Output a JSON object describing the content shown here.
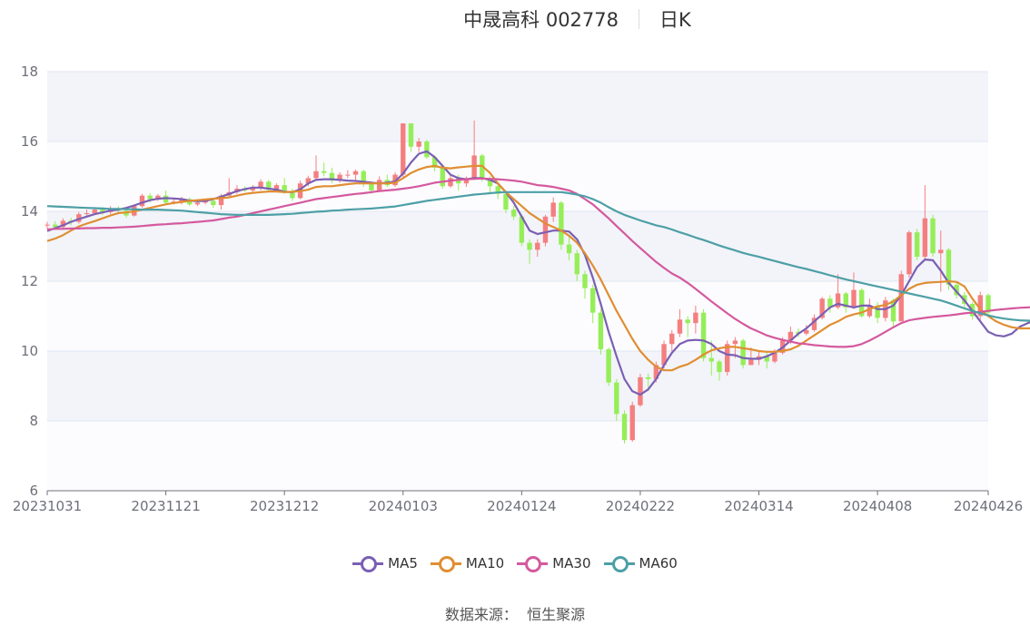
{
  "header": {
    "title": "中晟高科 002778",
    "period": "日K"
  },
  "source_text": "数据来源：  恒生聚源",
  "colors": {
    "up": "#f47f80",
    "down": "#95ee58",
    "band": "#f2f4f9",
    "grid": "#e0e6f1",
    "axis": "#6e7079",
    "text": "#333333"
  },
  "chart_data": {
    "type": "candlestick",
    "title": "中晟高科 002778",
    "xlabel": "",
    "ylabel": "",
    "ylim": [
      6,
      18
    ],
    "yticks": [
      6,
      8,
      10,
      12,
      14,
      16,
      18
    ],
    "x_tick_labels": [
      "20231031",
      "20231121",
      "20231212",
      "20240103",
      "20240124",
      "20240222",
      "20240314",
      "20240408",
      "20240426"
    ],
    "x_tick_indices": [
      0,
      15,
      30,
      45,
      60,
      75,
      90,
      105,
      119
    ],
    "grid": true,
    "legend_position": "bottom",
    "num_days": 120,
    "candles": [
      [
        13.6,
        13.62,
        13.7,
        13.5
      ],
      [
        13.62,
        13.55,
        13.72,
        13.48
      ],
      [
        13.55,
        13.73,
        13.8,
        13.5
      ],
      [
        13.73,
        13.7,
        13.82,
        13.6
      ],
      [
        13.7,
        13.92,
        13.98,
        13.65
      ],
      [
        13.92,
        13.95,
        14.05,
        13.85
      ],
      [
        13.95,
        14.05,
        14.12,
        13.9
      ],
      [
        14.05,
        13.98,
        14.12,
        13.9
      ],
      [
        13.98,
        14.08,
        14.15,
        13.92
      ],
      [
        14.08,
        14.02,
        14.15,
        13.95
      ],
      [
        14.02,
        13.88,
        14.08,
        13.82
      ],
      [
        13.88,
        14.15,
        14.2,
        13.85
      ],
      [
        14.15,
        14.45,
        14.5,
        14.1
      ],
      [
        14.45,
        14.35,
        14.52,
        14.25
      ],
      [
        14.35,
        14.45,
        14.5,
        14.3
      ],
      [
        14.45,
        14.25,
        14.6,
        14.2
      ],
      [
        14.25,
        14.28,
        14.35,
        14.2
      ],
      [
        14.28,
        14.35,
        14.42,
        14.2
      ],
      [
        14.35,
        14.2,
        14.4,
        14.15
      ],
      [
        14.2,
        14.25,
        14.3,
        14.15
      ],
      [
        14.25,
        14.3,
        14.35,
        14.2
      ],
      [
        14.3,
        14.18,
        14.38,
        14.1
      ],
      [
        14.18,
        14.45,
        14.5,
        14.05
      ],
      [
        14.45,
        14.55,
        14.95,
        14.4
      ],
      [
        14.55,
        14.65,
        14.75,
        14.5
      ],
      [
        14.65,
        14.6,
        14.72,
        14.55
      ],
      [
        14.6,
        14.68,
        14.75,
        14.55
      ],
      [
        14.68,
        14.85,
        14.92,
        14.6
      ],
      [
        14.85,
        14.62,
        14.9,
        14.55
      ],
      [
        14.62,
        14.75,
        14.8,
        14.55
      ],
      [
        14.75,
        14.55,
        14.95,
        14.5
      ],
      [
        14.55,
        14.38,
        14.65,
        14.3
      ],
      [
        14.38,
        14.8,
        14.88,
        14.35
      ],
      [
        14.8,
        14.95,
        15.02,
        14.72
      ],
      [
        14.95,
        15.15,
        15.6,
        14.9
      ],
      [
        15.15,
        15.1,
        15.4,
        15.0
      ],
      [
        15.1,
        14.88,
        15.25,
        14.8
      ],
      [
        14.88,
        15.05,
        15.12,
        14.82
      ],
      [
        15.05,
        15.05,
        15.18,
        14.95
      ],
      [
        15.05,
        15.15,
        15.2,
        14.85
      ],
      [
        15.15,
        14.78,
        15.2,
        14.7
      ],
      [
        14.78,
        14.6,
        14.85,
        14.5
      ],
      [
        14.6,
        14.9,
        15.0,
        14.55
      ],
      [
        14.9,
        14.75,
        15.05,
        14.7
      ],
      [
        14.75,
        15.05,
        15.12,
        14.7
      ],
      [
        15.05,
        16.52,
        16.52,
        14.98
      ],
      [
        16.52,
        15.85,
        16.4,
        15.7
      ],
      [
        15.85,
        16.0,
        16.1,
        15.7
      ],
      [
        16.0,
        15.55,
        16.05,
        15.5
      ],
      [
        15.55,
        15.25,
        15.6,
        15.15
      ],
      [
        15.25,
        14.72,
        15.3,
        14.65
      ],
      [
        14.72,
        14.95,
        15.05,
        14.68
      ],
      [
        14.95,
        14.8,
        15.05,
        14.6
      ],
      [
        14.8,
        14.95,
        15.0,
        14.7
      ],
      [
        14.95,
        15.6,
        16.6,
        14.9
      ],
      [
        15.6,
        14.92,
        15.65,
        14.85
      ],
      [
        14.92,
        14.72,
        15.0,
        14.55
      ],
      [
        14.72,
        14.5,
        14.8,
        14.35
      ],
      [
        14.5,
        14.05,
        14.58,
        13.95
      ],
      [
        14.05,
        13.85,
        14.15,
        13.75
      ],
      [
        13.85,
        13.1,
        13.9,
        13.0
      ],
      [
        13.1,
        12.9,
        13.2,
        12.5
      ],
      [
        12.9,
        13.1,
        13.2,
        12.7
      ],
      [
        13.1,
        13.85,
        13.9,
        13.0
      ],
      [
        13.85,
        14.25,
        14.4,
        13.7
      ],
      [
        14.25,
        13.05,
        14.3,
        12.9
      ],
      [
        13.05,
        12.8,
        13.3,
        12.6
      ],
      [
        12.8,
        12.2,
        12.9,
        12.0
      ],
      [
        12.2,
        11.8,
        12.3,
        11.5
      ],
      [
        11.8,
        11.1,
        11.9,
        10.8
      ],
      [
        11.1,
        10.05,
        11.2,
        9.9
      ],
      [
        10.05,
        9.1,
        10.1,
        9.0
      ],
      [
        9.1,
        8.2,
        9.2,
        8.0
      ],
      [
        8.2,
        7.45,
        8.3,
        7.35
      ],
      [
        7.45,
        8.45,
        8.55,
        7.4
      ],
      [
        8.45,
        9.25,
        9.35,
        8.4
      ],
      [
        9.25,
        9.2,
        9.35,
        8.85
      ],
      [
        9.2,
        9.6,
        9.7,
        9.1
      ],
      [
        9.6,
        10.2,
        10.3,
        9.5
      ],
      [
        10.2,
        10.5,
        10.6,
        10.0
      ],
      [
        10.5,
        10.9,
        11.2,
        10.4
      ],
      [
        10.9,
        10.8,
        11.0,
        10.4
      ],
      [
        10.8,
        11.1,
        11.3,
        10.5
      ],
      [
        11.1,
        9.8,
        11.2,
        9.7
      ],
      [
        9.8,
        9.7,
        10.3,
        9.3
      ],
      [
        9.7,
        9.4,
        9.75,
        9.15
      ],
      [
        9.4,
        10.2,
        10.3,
        9.3
      ],
      [
        10.2,
        10.3,
        10.4,
        9.8
      ],
      [
        10.3,
        9.6,
        10.35,
        9.5
      ],
      [
        9.6,
        9.75,
        10.1,
        9.6
      ],
      [
        9.75,
        9.85,
        10.0,
        9.6
      ],
      [
        9.85,
        9.7,
        10.0,
        9.5
      ],
      [
        9.7,
        9.95,
        10.05,
        9.65
      ],
      [
        9.95,
        10.3,
        10.4,
        9.9
      ],
      [
        10.3,
        10.55,
        10.7,
        10.2
      ],
      [
        10.55,
        10.5,
        10.65,
        10.4
      ],
      [
        10.5,
        10.6,
        10.75,
        10.45
      ],
      [
        10.6,
        10.95,
        11.05,
        10.55
      ],
      [
        10.95,
        11.5,
        11.55,
        10.9
      ],
      [
        11.5,
        11.25,
        11.6,
        11.1
      ],
      [
        11.25,
        11.65,
        12.2,
        11.2
      ],
      [
        11.65,
        11.25,
        11.7,
        11.1
      ],
      [
        11.25,
        11.75,
        12.25,
        11.2
      ],
      [
        11.75,
        11.0,
        11.8,
        10.95
      ],
      [
        11.0,
        11.3,
        11.5,
        10.95
      ],
      [
        11.3,
        10.95,
        11.4,
        10.8
      ],
      [
        10.95,
        11.45,
        11.55,
        10.85
      ],
      [
        11.45,
        10.85,
        11.5,
        10.7
      ],
      [
        10.85,
        12.2,
        12.3,
        10.9
      ],
      [
        12.2,
        13.4,
        13.45,
        12.1
      ],
      [
        13.4,
        12.7,
        13.5,
        12.6
      ],
      [
        12.7,
        13.8,
        14.75,
        12.6
      ],
      [
        13.8,
        12.8,
        13.9,
        12.7
      ],
      [
        12.8,
        12.9,
        13.45,
        11.7
      ],
      [
        12.9,
        11.9,
        12.95,
        11.75
      ],
      [
        11.9,
        11.6,
        12.0,
        11.5
      ],
      [
        11.6,
        11.35,
        11.7,
        11.2
      ],
      [
        11.35,
        11.0,
        11.4,
        10.9
      ],
      [
        11.0,
        11.6,
        11.7,
        10.9
      ],
      [
        11.6,
        11.1,
        11.65,
        11.0
      ]
    ],
    "series": [
      {
        "name": "MA5",
        "color": "#7b5fb3",
        "values": [
          13.44,
          13.52,
          13.6,
          13.7,
          13.78,
          13.85,
          13.92,
          13.97,
          14.02,
          14.05,
          14.1,
          14.17,
          14.25,
          14.32,
          14.36,
          14.38,
          14.37,
          14.35,
          14.31,
          14.29,
          14.3,
          14.35,
          14.42,
          14.5,
          14.58,
          14.64,
          14.68,
          14.68,
          14.65,
          14.62,
          14.56,
          14.55,
          14.63,
          14.8,
          14.9,
          14.92,
          14.92,
          14.9,
          14.88,
          14.87,
          14.85,
          14.82,
          14.8,
          14.82,
          14.86,
          15.08,
          15.4,
          15.65,
          15.72,
          15.55,
          15.3,
          15.05,
          14.95,
          14.92,
          14.95,
          14.95,
          14.9,
          14.8,
          14.55,
          14.25,
          13.85,
          13.45,
          13.35,
          13.4,
          13.45,
          13.45,
          13.42,
          13.2,
          12.75,
          12.1,
          11.35,
          10.55,
          9.85,
          9.2,
          8.85,
          8.75,
          8.9,
          9.2,
          9.6,
          9.95,
          10.2,
          10.3,
          10.32,
          10.3,
          10.2,
          10.0,
          9.9,
          9.88,
          9.8,
          9.78,
          9.78,
          9.85,
          9.95,
          10.1,
          10.3,
          10.5,
          10.65,
          10.85,
          11.05,
          11.25,
          11.35,
          11.3,
          11.25,
          11.3,
          11.3,
          11.2,
          11.2,
          11.3,
          11.6,
          12.0,
          12.4,
          12.62,
          12.6,
          12.3,
          11.95,
          11.7,
          11.45,
          11.15,
          10.85,
          10.55,
          10.45,
          10.42,
          10.5,
          10.7,
          10.8,
          10.88
        ]
      },
      {
        "name": "MA10",
        "color": "#e08e32",
        "values": [
          13.15,
          13.22,
          13.32,
          13.45,
          13.57,
          13.65,
          13.72,
          13.8,
          13.88,
          13.95,
          13.97,
          14.0,
          14.05,
          14.1,
          14.15,
          14.2,
          14.24,
          14.27,
          14.3,
          14.32,
          14.34,
          14.36,
          14.38,
          14.4,
          14.45,
          14.5,
          14.53,
          14.55,
          14.57,
          14.57,
          14.55,
          14.56,
          14.58,
          14.62,
          14.7,
          14.72,
          14.72,
          14.75,
          14.78,
          14.8,
          14.8,
          14.8,
          14.8,
          14.8,
          14.82,
          14.95,
          15.1,
          15.2,
          15.27,
          15.3,
          15.25,
          15.23,
          15.26,
          15.28,
          15.3,
          15.3,
          15.1,
          14.8,
          14.55,
          14.35,
          14.15,
          13.95,
          13.8,
          13.65,
          13.55,
          13.45,
          13.3,
          13.1,
          12.8,
          12.45,
          12.05,
          11.6,
          11.15,
          10.75,
          10.35,
          10.0,
          9.75,
          9.55,
          9.45,
          9.45,
          9.55,
          9.62,
          9.75,
          9.9,
          10.02,
          10.08,
          10.12,
          10.12,
          10.08,
          10.05,
          10.0,
          9.98,
          9.98,
          10.0,
          10.05,
          10.15,
          10.3,
          10.45,
          10.6,
          10.75,
          10.85,
          10.98,
          11.05,
          11.1,
          11.2,
          11.28,
          11.32,
          11.42,
          11.6,
          11.78,
          11.9,
          11.95,
          11.97,
          11.98,
          12.0,
          11.98,
          11.85,
          11.5,
          11.2,
          11.0,
          10.85,
          10.75,
          10.68,
          10.65,
          10.65,
          10.65
        ]
      },
      {
        "name": "MA30",
        "color": "#d4599e",
        "values": [
          13.48,
          13.5,
          13.5,
          13.51,
          13.51,
          13.52,
          13.52,
          13.53,
          13.53,
          13.54,
          13.55,
          13.56,
          13.58,
          13.6,
          13.62,
          13.63,
          13.65,
          13.66,
          13.68,
          13.7,
          13.72,
          13.74,
          13.78,
          13.82,
          13.85,
          13.9,
          13.95,
          14.0,
          14.05,
          14.1,
          14.15,
          14.2,
          14.25,
          14.3,
          14.35,
          14.38,
          14.41,
          14.44,
          14.47,
          14.5,
          14.52,
          14.55,
          14.58,
          14.6,
          14.62,
          14.65,
          14.68,
          14.72,
          14.77,
          14.82,
          14.85,
          14.88,
          14.9,
          14.92,
          14.93,
          14.94,
          14.93,
          14.92,
          14.9,
          14.88,
          14.85,
          14.8,
          14.75,
          14.73,
          14.7,
          14.65,
          14.6,
          14.5,
          14.35,
          14.2,
          14.0,
          13.8,
          13.58,
          13.37,
          13.15,
          12.95,
          12.75,
          12.55,
          12.38,
          12.22,
          12.1,
          11.95,
          11.78,
          11.6,
          11.42,
          11.25,
          11.08,
          10.92,
          10.78,
          10.65,
          10.55,
          10.45,
          10.38,
          10.32,
          10.27,
          10.22,
          10.2,
          10.17,
          10.15,
          10.13,
          10.12,
          10.12,
          10.14,
          10.2,
          10.3,
          10.42,
          10.55,
          10.68,
          10.8,
          10.88,
          10.92,
          10.95,
          10.98,
          11.0,
          11.02,
          11.05,
          11.08,
          11.1,
          11.12,
          11.15,
          11.18,
          11.2,
          11.22,
          11.24,
          11.25,
          11.27
        ]
      },
      {
        "name": "MA60",
        "color": "#4d9fa6",
        "values": [
          14.15,
          14.14,
          14.13,
          14.12,
          14.11,
          14.1,
          14.09,
          14.08,
          14.07,
          14.07,
          14.06,
          14.06,
          14.05,
          14.05,
          14.05,
          14.04,
          14.03,
          14.02,
          14.0,
          13.98,
          13.96,
          13.94,
          13.92,
          13.91,
          13.9,
          13.9,
          13.9,
          13.9,
          13.9,
          13.91,
          13.92,
          13.93,
          13.95,
          13.97,
          13.99,
          14.0,
          14.02,
          14.03,
          14.05,
          14.06,
          14.07,
          14.08,
          14.1,
          14.12,
          14.14,
          14.18,
          14.22,
          14.26,
          14.3,
          14.33,
          14.36,
          14.39,
          14.42,
          14.45,
          14.48,
          14.5,
          14.52,
          14.54,
          14.55,
          14.55,
          14.55,
          14.55,
          14.55,
          14.55,
          14.55,
          14.55,
          14.52,
          14.48,
          14.43,
          14.35,
          14.25,
          14.12,
          14.0,
          13.9,
          13.82,
          13.74,
          13.67,
          13.6,
          13.55,
          13.48,
          13.4,
          13.33,
          13.25,
          13.18,
          13.1,
          13.02,
          12.95,
          12.88,
          12.81,
          12.75,
          12.7,
          12.64,
          12.58,
          12.52,
          12.46,
          12.4,
          12.35,
          12.29,
          12.23,
          12.17,
          12.11,
          12.05,
          12.0,
          11.95,
          11.9,
          11.85,
          11.8,
          11.75,
          11.7,
          11.65,
          11.6,
          11.55,
          11.5,
          11.45,
          11.38,
          11.3,
          11.22,
          11.15,
          11.08,
          11.02,
          10.97,
          10.93,
          10.9,
          10.88,
          10.87,
          10.86
        ]
      }
    ]
  }
}
